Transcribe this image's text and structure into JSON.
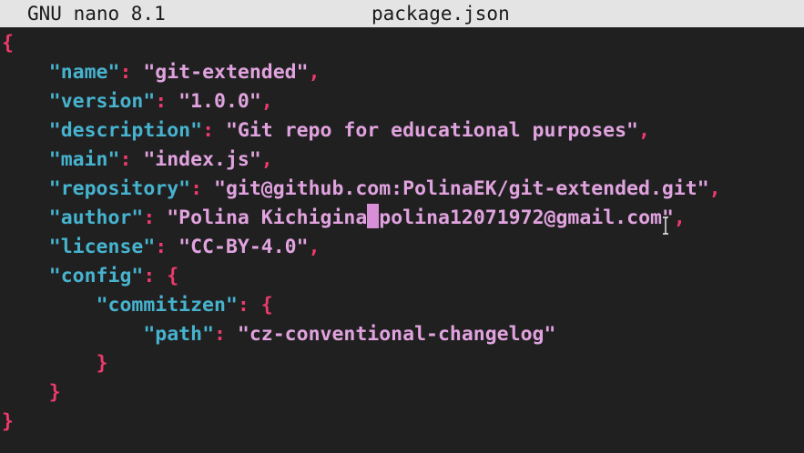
{
  "titlebar": {
    "app_name": "GNU nano 8.1",
    "file_name": "package.json"
  },
  "editor": {
    "lines": [
      {
        "open": "{"
      },
      {
        "indent": "    ",
        "key": "\"name\"",
        "sep": ": ",
        "value": "\"git-extended\"",
        "end": ","
      },
      {
        "indent": "    ",
        "key": "\"version\"",
        "sep": ": ",
        "value": "\"1.0.0\"",
        "end": ","
      },
      {
        "indent": "    ",
        "key": "\"description\"",
        "sep": ": ",
        "value": "\"Git repo for educational purposes\"",
        "end": ","
      },
      {
        "indent": "    ",
        "key": "\"main\"",
        "sep": ": ",
        "value": "\"index.js\"",
        "end": ","
      },
      {
        "indent": "    ",
        "key": "\"repository\"",
        "sep": ": ",
        "value": "\"git@github.com:PolinaEK/git-extended.git\"",
        "end": ","
      },
      {
        "indent": "    ",
        "key": "\"author\"",
        "sep": ": ",
        "value_before_cursor": "\"Polina Kichigina",
        "value_after_cursor": "polina12071972@gmail.com\"",
        "end": ","
      },
      {
        "indent": "    ",
        "key": "\"license\"",
        "sep": ": ",
        "value": "\"CC-BY-4.0\"",
        "end": ","
      },
      {
        "indent": "    ",
        "key": "\"config\"",
        "sep": ": ",
        "brace": "{"
      },
      {
        "indent": "        ",
        "key": "\"commitizen\"",
        "sep": ": ",
        "brace": "{"
      },
      {
        "indent": "            ",
        "key": "\"path\"",
        "sep": ": ",
        "value": "\"cz-conventional-changelog\""
      },
      {
        "indent": "        ",
        "close": "}"
      },
      {
        "indent": "    ",
        "close": "}"
      },
      {
        "close": "}"
      }
    ]
  }
}
